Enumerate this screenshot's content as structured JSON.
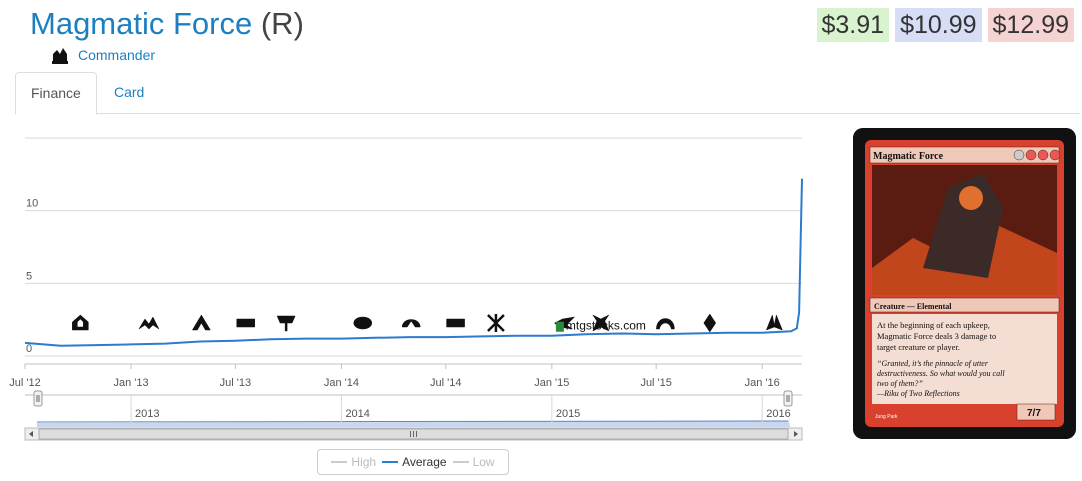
{
  "card": {
    "name": "Magmatic Force",
    "rarity": "(R)",
    "set_name": "Commander",
    "set_icon": "commander-set-icon"
  },
  "prices": {
    "low": "$3.91",
    "average": "$10.99",
    "high": "$12.99",
    "colors": {
      "low_bg": "#d9f3cf",
      "avg_bg": "#d6ddf4",
      "high_bg": "#f6d3d3"
    }
  },
  "tabs": [
    {
      "label": "Finance",
      "active": true
    },
    {
      "label": "Card",
      "active": false
    }
  ],
  "chart_data": {
    "type": "line",
    "title": "",
    "xlabel": "",
    "ylabel": "",
    "x_range": [
      "2012-07-01",
      "2016-03-10"
    ],
    "ylim": [
      0,
      15
    ],
    "yticks": [
      0,
      5,
      10
    ],
    "xticks": [
      {
        "date": "2012-07-01",
        "label": "Jul '12"
      },
      {
        "date": "2013-01-01",
        "label": "Jan '13"
      },
      {
        "date": "2013-07-01",
        "label": "Jul '13"
      },
      {
        "date": "2014-01-01",
        "label": "Jan '14"
      },
      {
        "date": "2014-07-01",
        "label": "Jul '14"
      },
      {
        "date": "2015-01-01",
        "label": "Jan '15"
      },
      {
        "date": "2015-07-01",
        "label": "Jul '15"
      },
      {
        "date": "2016-01-01",
        "label": "Jan '16"
      }
    ],
    "grid": true,
    "legend_position": "bottom-center",
    "legend": [
      {
        "name": "High",
        "enabled": false
      },
      {
        "name": "Average",
        "enabled": true
      },
      {
        "name": "Low",
        "enabled": false
      }
    ],
    "series": [
      {
        "name": "Average",
        "color": "#2b7bd1",
        "points": [
          [
            "2012-07-01",
            0.9
          ],
          [
            "2012-09-01",
            0.7
          ],
          [
            "2012-11-01",
            0.75
          ],
          [
            "2013-01-01",
            0.8
          ],
          [
            "2013-03-01",
            0.85
          ],
          [
            "2013-05-01",
            1.0
          ],
          [
            "2013-07-01",
            1.05
          ],
          [
            "2013-09-01",
            1.15
          ],
          [
            "2013-11-01",
            1.2
          ],
          [
            "2014-01-01",
            1.2
          ],
          [
            "2014-03-01",
            1.25
          ],
          [
            "2014-05-01",
            1.3
          ],
          [
            "2014-07-01",
            1.3
          ],
          [
            "2014-09-01",
            1.35
          ],
          [
            "2014-11-01",
            1.4
          ],
          [
            "2015-01-01",
            1.4
          ],
          [
            "2015-03-01",
            1.5
          ],
          [
            "2015-05-01",
            1.55
          ],
          [
            "2015-07-01",
            1.5
          ],
          [
            "2015-09-01",
            1.55
          ],
          [
            "2015-11-01",
            1.6
          ],
          [
            "2016-01-01",
            1.6
          ],
          [
            "2016-02-20",
            1.7
          ],
          [
            "2016-03-01",
            1.9
          ],
          [
            "2016-03-05",
            3.0
          ],
          [
            "2016-03-10",
            12.2
          ]
        ]
      }
    ],
    "set_releases": [
      {
        "date": "2012-10-05",
        "set": "return-to-ravnica-icon"
      },
      {
        "date": "2013-02-01",
        "set": "gatecrash-icon"
      },
      {
        "date": "2013-05-03",
        "set": "dragons-maze-icon"
      },
      {
        "date": "2013-07-19",
        "set": "magic-2014-icon"
      },
      {
        "date": "2013-09-27",
        "set": "theros-icon"
      },
      {
        "date": "2014-02-07",
        "set": "born-of-the-gods-icon"
      },
      {
        "date": "2014-05-02",
        "set": "journey-into-nyx-icon"
      },
      {
        "date": "2014-07-18",
        "set": "magic-2015-icon"
      },
      {
        "date": "2014-09-26",
        "set": "khans-of-tarkir-icon"
      },
      {
        "date": "2015-01-23",
        "set": "fate-reforged-icon"
      },
      {
        "date": "2015-03-27",
        "set": "dragons-of-tarkir-icon"
      },
      {
        "date": "2015-07-17",
        "set": "magic-origins-icon"
      },
      {
        "date": "2015-10-02",
        "set": "battle-for-zendikar-icon"
      },
      {
        "date": "2016-01-22",
        "set": "oath-of-the-gatewatch-icon"
      }
    ],
    "watermark": "mtgstocks.com",
    "navigator": {
      "year_labels": [
        "2013",
        "2014",
        "2015",
        "2016"
      ]
    }
  },
  "card_image": {
    "name": "Magmatic Force",
    "mana_cost": "5RRR",
    "type_line": "Creature — Elemental",
    "rules_text": "At the beginning of each upkeep, Magmatic Force deals 3 damage to target creature or player.",
    "flavor_text": "“Granted, it’s the pinnacle of utter destructiveness. So what would you call two of them?”",
    "flavor_attribution": "—Riku of Two Reflections",
    "pt": "7/7",
    "artist": "Jung Park"
  }
}
